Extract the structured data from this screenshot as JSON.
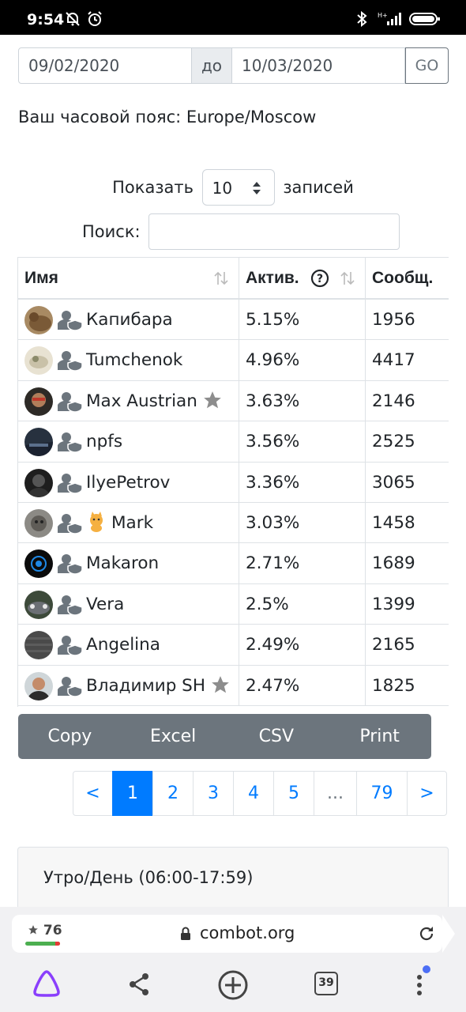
{
  "status_bar": {
    "time": "9:54",
    "battery": ""
  },
  "filter": {
    "date_from": "09/02/2020",
    "separator": "до",
    "date_to": "10/03/2020",
    "go_label": "GO",
    "timezone_text": "Ваш часовой пояс: Europe/Moscow"
  },
  "table_controls": {
    "show_label": "Показать",
    "page_size": "10",
    "records_label": "записей",
    "search_label": "Поиск:",
    "search_value": ""
  },
  "table": {
    "columns": [
      "Имя",
      "Актив.",
      "Сообщ."
    ],
    "rows": [
      {
        "name": "Капибара",
        "activity": "5.15%",
        "messages": "1956"
      },
      {
        "name": "Tumchenok",
        "activity": "4.96%",
        "messages": "4417"
      },
      {
        "name": "Max Austrian",
        "activity": "3.63%",
        "messages": "2146"
      },
      {
        "name": "npfs",
        "activity": "3.56%",
        "messages": "2525"
      },
      {
        "name": "IlyePetrov",
        "activity": "3.36%",
        "messages": "3065"
      },
      {
        "name": "Mark",
        "activity": "3.03%",
        "messages": "1458"
      },
      {
        "name": "Makaron",
        "activity": "2.71%",
        "messages": "1689"
      },
      {
        "name": "Vera",
        "activity": "2.5%",
        "messages": "1399"
      },
      {
        "name": "Angelina",
        "activity": "2.49%",
        "messages": "2165"
      },
      {
        "name": "Владимир SH",
        "activity": "2.47%",
        "messages": "1825"
      }
    ]
  },
  "export_buttons": [
    "Copy",
    "Excel",
    "CSV",
    "Print"
  ],
  "pagination": {
    "prev": "<",
    "pages": [
      "1",
      "2",
      "3",
      "4",
      "5",
      "...",
      "79"
    ],
    "next": ">",
    "current": "1"
  },
  "card": {
    "title": "Утро/День (06:00-17:59)"
  },
  "browser": {
    "rating": "76",
    "domain": "combot.org",
    "tabs_count": "39"
  },
  "colors": {
    "primary": "#007bff",
    "secondary": "#6c757d",
    "border": "#dee2e6",
    "alice": "#8a3ffc"
  }
}
